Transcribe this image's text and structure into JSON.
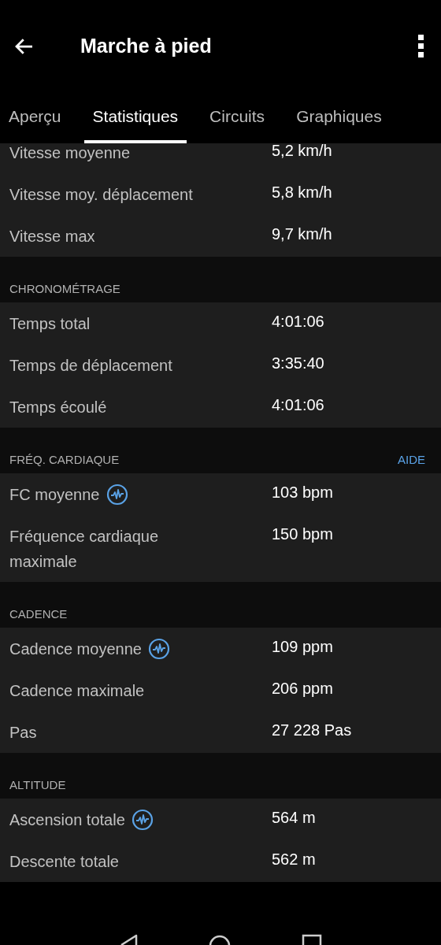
{
  "app_bar": {
    "title": "Marche à pied"
  },
  "tabs": [
    {
      "label": "Aperçu",
      "selected": false
    },
    {
      "label": "Statistiques",
      "selected": true
    },
    {
      "label": "Circuits",
      "selected": false
    },
    {
      "label": "Graphiques",
      "selected": false
    }
  ],
  "sections": [
    {
      "rows": [
        {
          "label": "Vitesse moyenne",
          "value": "5,2 km/h",
          "chart_link": false
        },
        {
          "label": "Vitesse moy. déplacement",
          "value": "5,8 km/h",
          "chart_link": false
        },
        {
          "label": "Vitesse max",
          "value": "9,7 km/h",
          "chart_link": false
        }
      ]
    },
    {
      "title": "CHRONOMÉTRAGE",
      "rows": [
        {
          "label": "Temps total",
          "value": "4:01:06",
          "chart_link": false
        },
        {
          "label": "Temps de déplacement",
          "value": "3:35:40",
          "chart_link": false
        },
        {
          "label": "Temps écoulé",
          "value": "4:01:06",
          "chart_link": false
        }
      ]
    },
    {
      "title": "FRÉQ. CARDIAQUE",
      "action": "AIDE",
      "rows": [
        {
          "label": "FC moyenne",
          "value": "103 bpm",
          "chart_link": true
        },
        {
          "label": "Fréquence cardiaque maximale",
          "value": "150 bpm",
          "chart_link": false
        }
      ]
    },
    {
      "title": "CADENCE",
      "rows": [
        {
          "label": "Cadence moyenne",
          "value": "109 ppm",
          "chart_link": true
        },
        {
          "label": "Cadence maximale",
          "value": "206 ppm",
          "chart_link": false
        },
        {
          "label": "Pas",
          "value": "27 228 Pas",
          "chart_link": false
        }
      ]
    },
    {
      "title": "ALTITUDE",
      "rows": [
        {
          "label": "Ascension totale",
          "value": "564 m",
          "chart_link": true
        },
        {
          "label": "Descente totale",
          "value": "562 m",
          "chart_link": false
        }
      ]
    }
  ]
}
